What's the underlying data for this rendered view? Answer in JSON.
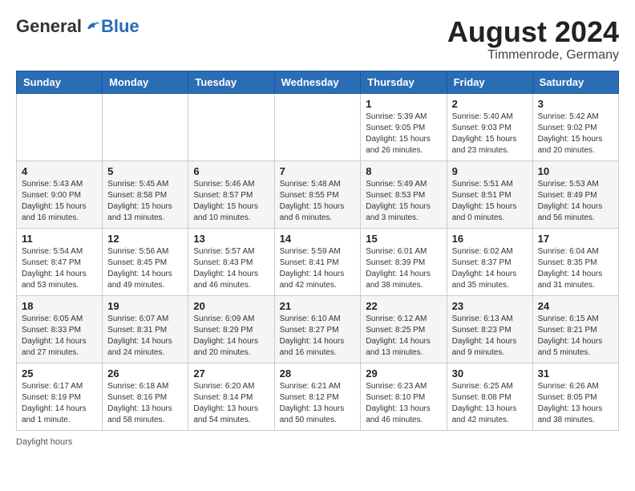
{
  "header": {
    "logo_general": "General",
    "logo_blue": "Blue",
    "month_year": "August 2024",
    "location": "Timmenrode, Germany"
  },
  "days_of_week": [
    "Sunday",
    "Monday",
    "Tuesday",
    "Wednesday",
    "Thursday",
    "Friday",
    "Saturday"
  ],
  "weeks": [
    [
      {
        "day": "",
        "info": ""
      },
      {
        "day": "",
        "info": ""
      },
      {
        "day": "",
        "info": ""
      },
      {
        "day": "",
        "info": ""
      },
      {
        "day": "1",
        "info": "Sunrise: 5:39 AM\nSunset: 9:05 PM\nDaylight: 15 hours\nand 26 minutes."
      },
      {
        "day": "2",
        "info": "Sunrise: 5:40 AM\nSunset: 9:03 PM\nDaylight: 15 hours\nand 23 minutes."
      },
      {
        "day": "3",
        "info": "Sunrise: 5:42 AM\nSunset: 9:02 PM\nDaylight: 15 hours\nand 20 minutes."
      }
    ],
    [
      {
        "day": "4",
        "info": "Sunrise: 5:43 AM\nSunset: 9:00 PM\nDaylight: 15 hours\nand 16 minutes."
      },
      {
        "day": "5",
        "info": "Sunrise: 5:45 AM\nSunset: 8:58 PM\nDaylight: 15 hours\nand 13 minutes."
      },
      {
        "day": "6",
        "info": "Sunrise: 5:46 AM\nSunset: 8:57 PM\nDaylight: 15 hours\nand 10 minutes."
      },
      {
        "day": "7",
        "info": "Sunrise: 5:48 AM\nSunset: 8:55 PM\nDaylight: 15 hours\nand 6 minutes."
      },
      {
        "day": "8",
        "info": "Sunrise: 5:49 AM\nSunset: 8:53 PM\nDaylight: 15 hours\nand 3 minutes."
      },
      {
        "day": "9",
        "info": "Sunrise: 5:51 AM\nSunset: 8:51 PM\nDaylight: 15 hours\nand 0 minutes."
      },
      {
        "day": "10",
        "info": "Sunrise: 5:53 AM\nSunset: 8:49 PM\nDaylight: 14 hours\nand 56 minutes."
      }
    ],
    [
      {
        "day": "11",
        "info": "Sunrise: 5:54 AM\nSunset: 8:47 PM\nDaylight: 14 hours\nand 53 minutes."
      },
      {
        "day": "12",
        "info": "Sunrise: 5:56 AM\nSunset: 8:45 PM\nDaylight: 14 hours\nand 49 minutes."
      },
      {
        "day": "13",
        "info": "Sunrise: 5:57 AM\nSunset: 8:43 PM\nDaylight: 14 hours\nand 46 minutes."
      },
      {
        "day": "14",
        "info": "Sunrise: 5:59 AM\nSunset: 8:41 PM\nDaylight: 14 hours\nand 42 minutes."
      },
      {
        "day": "15",
        "info": "Sunrise: 6:01 AM\nSunset: 8:39 PM\nDaylight: 14 hours\nand 38 minutes."
      },
      {
        "day": "16",
        "info": "Sunrise: 6:02 AM\nSunset: 8:37 PM\nDaylight: 14 hours\nand 35 minutes."
      },
      {
        "day": "17",
        "info": "Sunrise: 6:04 AM\nSunset: 8:35 PM\nDaylight: 14 hours\nand 31 minutes."
      }
    ],
    [
      {
        "day": "18",
        "info": "Sunrise: 6:05 AM\nSunset: 8:33 PM\nDaylight: 14 hours\nand 27 minutes."
      },
      {
        "day": "19",
        "info": "Sunrise: 6:07 AM\nSunset: 8:31 PM\nDaylight: 14 hours\nand 24 minutes."
      },
      {
        "day": "20",
        "info": "Sunrise: 6:09 AM\nSunset: 8:29 PM\nDaylight: 14 hours\nand 20 minutes."
      },
      {
        "day": "21",
        "info": "Sunrise: 6:10 AM\nSunset: 8:27 PM\nDaylight: 14 hours\nand 16 minutes."
      },
      {
        "day": "22",
        "info": "Sunrise: 6:12 AM\nSunset: 8:25 PM\nDaylight: 14 hours\nand 13 minutes."
      },
      {
        "day": "23",
        "info": "Sunrise: 6:13 AM\nSunset: 8:23 PM\nDaylight: 14 hours\nand 9 minutes."
      },
      {
        "day": "24",
        "info": "Sunrise: 6:15 AM\nSunset: 8:21 PM\nDaylight: 14 hours\nand 5 minutes."
      }
    ],
    [
      {
        "day": "25",
        "info": "Sunrise: 6:17 AM\nSunset: 8:19 PM\nDaylight: 14 hours\nand 1 minute."
      },
      {
        "day": "26",
        "info": "Sunrise: 6:18 AM\nSunset: 8:16 PM\nDaylight: 13 hours\nand 58 minutes."
      },
      {
        "day": "27",
        "info": "Sunrise: 6:20 AM\nSunset: 8:14 PM\nDaylight: 13 hours\nand 54 minutes."
      },
      {
        "day": "28",
        "info": "Sunrise: 6:21 AM\nSunset: 8:12 PM\nDaylight: 13 hours\nand 50 minutes."
      },
      {
        "day": "29",
        "info": "Sunrise: 6:23 AM\nSunset: 8:10 PM\nDaylight: 13 hours\nand 46 minutes."
      },
      {
        "day": "30",
        "info": "Sunrise: 6:25 AM\nSunset: 8:08 PM\nDaylight: 13 hours\nand 42 minutes."
      },
      {
        "day": "31",
        "info": "Sunrise: 6:26 AM\nSunset: 8:05 PM\nDaylight: 13 hours\nand 38 minutes."
      }
    ]
  ],
  "footer": {
    "daylight_hours_label": "Daylight hours"
  }
}
